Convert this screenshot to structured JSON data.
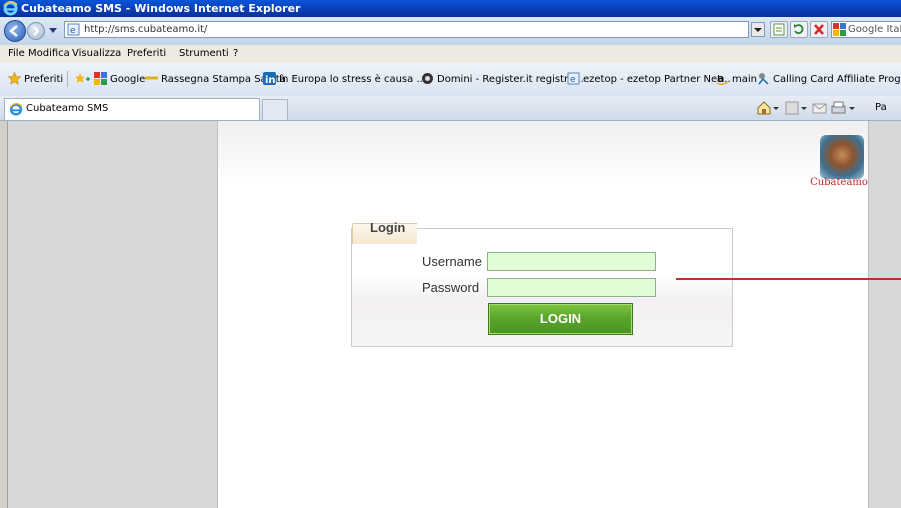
{
  "window": {
    "title": "Cubateamo SMS - Windows Internet Explorer"
  },
  "address": {
    "url": "http://sms.cubateamo.it/",
    "search_text": "Google Itali"
  },
  "menu": [
    "File",
    "Modifica",
    "Visualizza",
    "Preferiti",
    "Strumenti",
    "?"
  ],
  "favorites": {
    "label": "Preferiti",
    "items": [
      "Google",
      "Rassegna Stampa Sanità",
      "In Europa lo stress è causa ...",
      "Domini - Register.it registra...",
      "ezetop - ezetop Partner Net...",
      "main",
      "Calling Card Affiliate Progra..."
    ]
  },
  "tab": {
    "label": "Cubateamo SMS",
    "cmd_page": "Pa"
  },
  "page": {
    "logo_text": "Cubateamo",
    "login": {
      "legend": "Login",
      "username_label": "Username",
      "password_label": "Password",
      "username_value": "",
      "password_value": "",
      "button_label": "LOGIN"
    }
  },
  "colors": {
    "accent_green": "#5aa62c",
    "input_bg": "#e2fbd7",
    "logo_red": "#c0282d",
    "marker_red": "#c62d2d"
  }
}
